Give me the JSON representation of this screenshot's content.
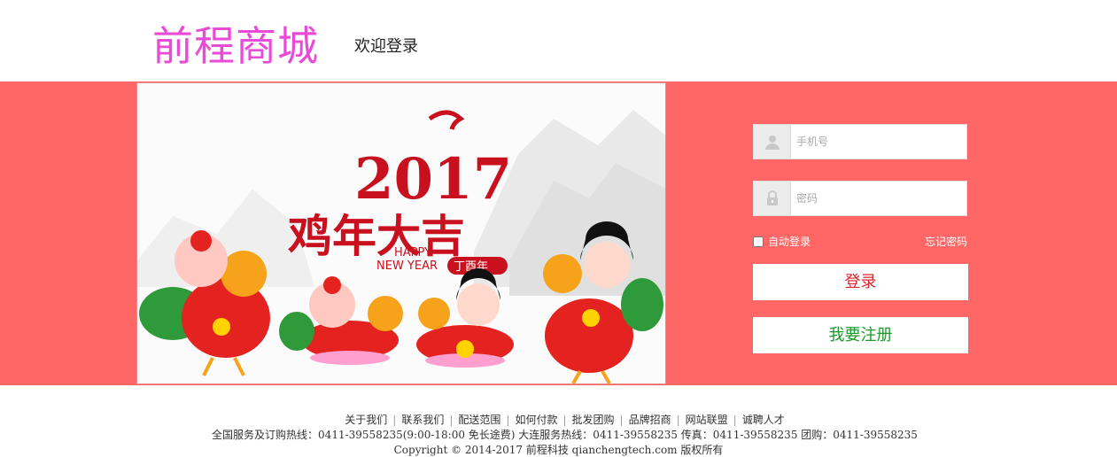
{
  "header": {
    "logo": "前程商城",
    "welcome": "欢迎登录"
  },
  "promo": {
    "year": "2017",
    "headline": "鸡年大吉",
    "happy": "HAPPY",
    "new_year": "NEW YEAR",
    "badge": "丁酉年"
  },
  "login": {
    "phone_placeholder": "手机号",
    "password_placeholder": "密码",
    "auto_login": "自动登录",
    "forgot": "忘记密码",
    "login_button": "登录",
    "register_button": "我要注册"
  },
  "footer": {
    "links": [
      "关于我们",
      "联系我们",
      "配送范围",
      "如何付款",
      "批发团购",
      "品牌招商",
      "网站联盟",
      "诚聘人才"
    ],
    "hotline": "全国服务及订购热线：0411-39558235(9:00-18:00 免长途费)  大连服务热线：0411-39558235  传真：0411-39558235  团购：0411-39558235",
    "copyright": "Copyright © 2014-2017  前程科技 qianchengtech.com 版权所有"
  },
  "colors": {
    "banner_bg": "#ff6666",
    "logo": "#e84bd6",
    "login_text": "#e0202a",
    "register_text": "#1a9a2a"
  }
}
